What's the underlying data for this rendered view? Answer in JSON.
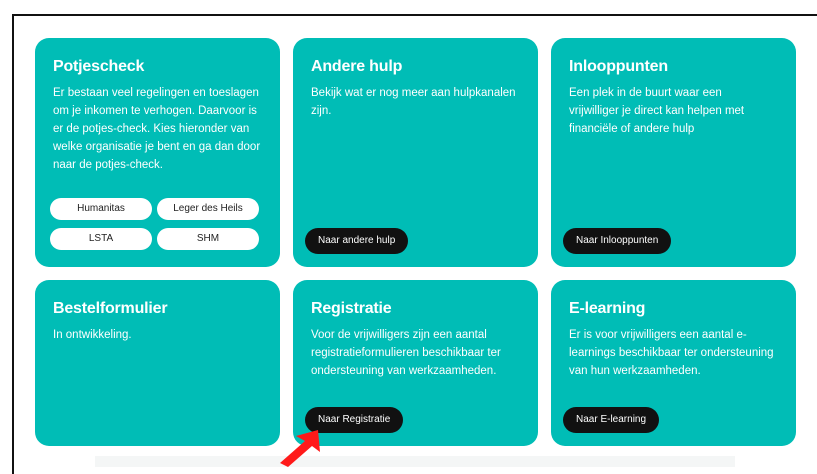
{
  "cards": [
    {
      "title": "Potjescheck",
      "text": "Er bestaan veel regelingen en toeslagen om je inkomen te verhogen. Daarvoor is er de potjes-check. Kies hieronder van welke organisatie je bent en ga dan door naar de potjes-check.",
      "pills": [
        "Humanitas",
        "Leger des Heils",
        "LSTA",
        "SHM"
      ]
    },
    {
      "title": "Andere hulp",
      "text": "Bekijk wat er nog meer aan hulpkanalen zijn.",
      "button": "Naar andere hulp"
    },
    {
      "title": "Inlooppunten",
      "text": "Een plek in de buurt waar een vrijwilliger je direct kan helpen met financiële of andere hulp",
      "button": "Naar Inlooppunten"
    },
    {
      "title": "Bestelformulier",
      "text": "In ontwikkeling."
    },
    {
      "title": "Registratie",
      "text": "Voor de vrijwilligers zijn een aantal registratieformulieren beschikbaar ter ondersteuning van werkzaamheden.",
      "button": "Naar Registratie"
    },
    {
      "title": "E-learning",
      "text": "Er is voor vrijwilligers een aantal e-learnings beschikbaar ter ondersteuning van hun werkzaamheden.",
      "button": "Naar E-learning"
    }
  ],
  "colors": {
    "card": "#00bdb6",
    "button": "#111111",
    "arrow": "#ff1a1a"
  },
  "icons": {
    "pointer": "red-arrow-icon"
  }
}
